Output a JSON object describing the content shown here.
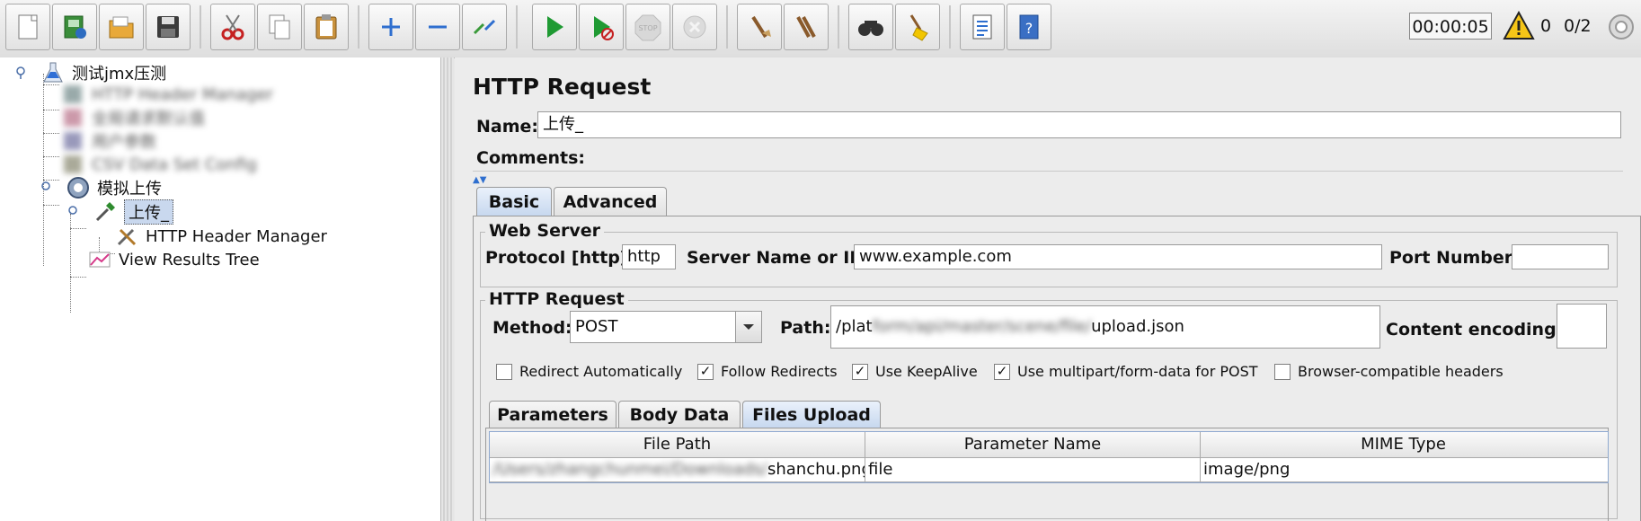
{
  "toolbar": {
    "buttons": [
      {
        "icon": "new-file-icon"
      },
      {
        "icon": "templates-icon"
      },
      {
        "icon": "open-icon"
      },
      {
        "icon": "save-icon"
      },
      {
        "icon": "cut-icon"
      },
      {
        "icon": "copy-icon"
      },
      {
        "icon": "paste-icon"
      },
      {
        "icon": "expand-icon"
      },
      {
        "icon": "collapse-icon"
      },
      {
        "icon": "toggle-icon"
      },
      {
        "icon": "start-icon"
      },
      {
        "icon": "start-no-pause-icon"
      },
      {
        "icon": "stop-icon"
      },
      {
        "icon": "shutdown-icon"
      },
      {
        "icon": "clear-icon"
      },
      {
        "icon": "clear-all-icon"
      },
      {
        "icon": "search-icon"
      },
      {
        "icon": "reset-search-icon"
      },
      {
        "icon": "function-helper-icon"
      },
      {
        "icon": "help-icon"
      }
    ],
    "timer": "00:00:05",
    "warnings": "0",
    "threads": "0/2"
  },
  "tree": {
    "root": "测试jmx压测",
    "blurred": [
      "HTTP Header Manager",
      "全局请求默认值",
      "用户参数",
      "CSV Data Set Config"
    ],
    "thread_group": "模拟上传",
    "sampler": "上传_",
    "header_manager": "HTTP Header Manager",
    "results_tree": "View Results Tree"
  },
  "panel": {
    "title": "HTTP Request",
    "name_label": "Name:",
    "name_value": "上传_",
    "comments_label": "Comments:",
    "tabs": [
      "Basic",
      "Advanced"
    ],
    "web_server": {
      "legend": "Web Server",
      "protocol_label": "Protocol [http]:",
      "protocol_value": "http",
      "server_label": "Server Name or IP:",
      "server_value": "www.example.com",
      "port_label": "Port Number:",
      "port_value": ""
    },
    "http_request": {
      "legend": "HTTP Request",
      "method_label": "Method:",
      "method_value": "POST",
      "path_label": "Path:",
      "path_prefix": "/plat",
      "path_blurred": "form/api/master/scene/file/",
      "path_suffix": "upload.json",
      "encoding_label": "Content encoding:",
      "encoding_value": ""
    },
    "checkboxes": [
      {
        "label": "Redirect Automatically",
        "checked": ""
      },
      {
        "label": "Follow Redirects",
        "checked": "✓"
      },
      {
        "label": "Use KeepAlive",
        "checked": "✓"
      },
      {
        "label": "Use multipart/form-data for POST",
        "checked": "✓"
      },
      {
        "label": "Browser-compatible headers",
        "checked": ""
      }
    ],
    "subtabs": [
      "Parameters",
      "Body Data",
      "Files Upload"
    ],
    "files_table": {
      "headers": [
        "File Path",
        "Parameter Name",
        "MIME Type"
      ],
      "rows": [
        {
          "path_blurred": "/Users/zhangchunmei/Downloads/",
          "path_visible": "shanchu.png",
          "param": "file",
          "mime": "image/png"
        }
      ]
    }
  }
}
